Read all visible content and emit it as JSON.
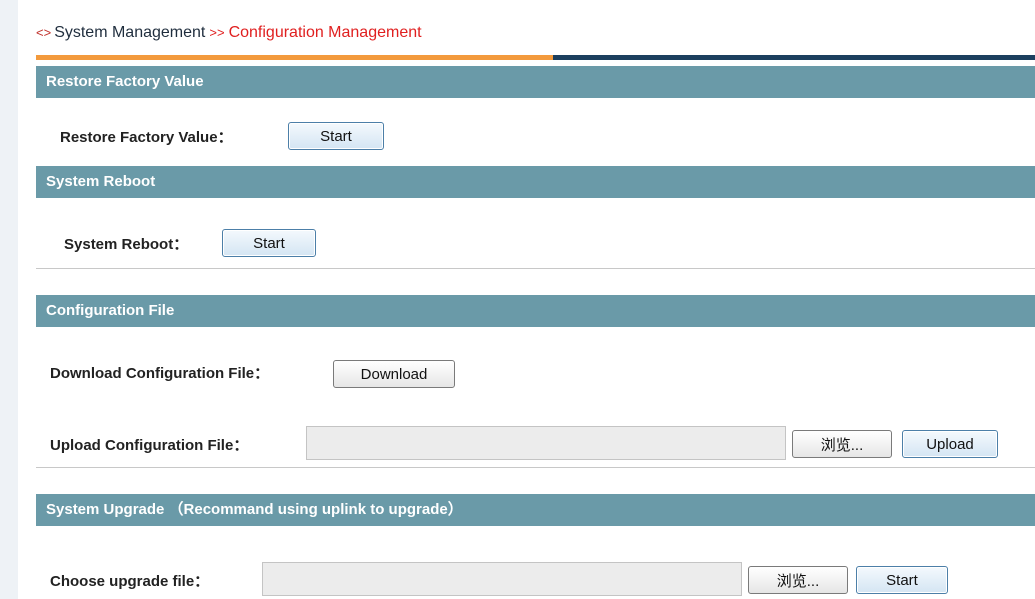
{
  "breadcrumb": {
    "arrow": "<>",
    "root": "System Management",
    "separator": ">>",
    "current": "Configuration Management"
  },
  "sections": {
    "restore": {
      "header": "Restore Factory Value",
      "label": "Restore Factory Value：",
      "button": "Start"
    },
    "reboot": {
      "header": "System Reboot",
      "label": "System Reboot：",
      "button": "Start"
    },
    "config": {
      "header": "Configuration File",
      "download_label": "Download Configuration File：",
      "download_button": "Download",
      "upload_label": "Upload Configuration File：",
      "browse_button": "浏览...",
      "upload_button": "Upload"
    },
    "upgrade": {
      "header": "System Upgrade  （Recommand using uplink to upgrade）",
      "label": "Choose upgrade file：",
      "browse_button": "浏览...",
      "start_button": "Start"
    }
  },
  "colors": {
    "section_header_bg": "#6a9aa8",
    "accent_orange": "#f39a3c",
    "accent_navy": "#1c3f5e",
    "breadcrumb_current": "#e02020"
  }
}
